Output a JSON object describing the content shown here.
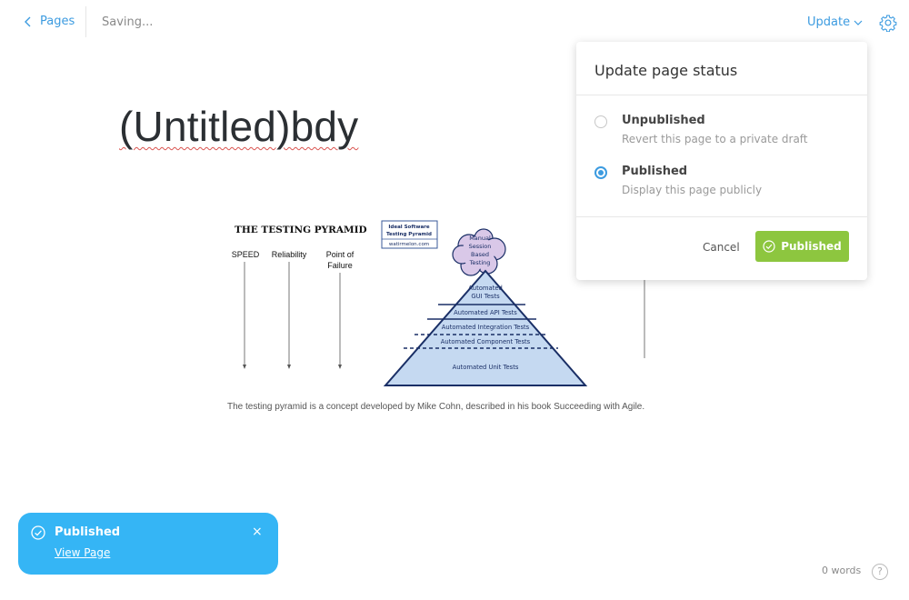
{
  "topbar": {
    "back_label": "Pages",
    "status": "Saving...",
    "update_label": "Update"
  },
  "page": {
    "title": "(Untitled)bdy",
    "caption": "The testing pyramid is a concept developed by Mike Cohn, described in his book Succeeding with Agile."
  },
  "figure": {
    "heading": "THE TESTING PYRAMID",
    "badge_line1": "Ideal Software",
    "badge_line2": "Testing Pyramid",
    "badge_line3": "watirmelon.com",
    "col1": "SPEED",
    "col2": "Reliability",
    "col3_line1": "Point of",
    "col3_line2": "Failure",
    "cloud_line1": "Manual",
    "cloud_line2": "Session",
    "cloud_line3": "Based",
    "cloud_line4": "Testing",
    "layer_gui_1": "Automated",
    "layer_gui_2": "GUI Tests",
    "layer_api": "Automated API Tests",
    "layer_integration": "Automated Integration Tests",
    "layer_component": "Automated Component Tests",
    "layer_unit": "Automated Unit Tests"
  },
  "popover": {
    "title": "Update page status",
    "options": [
      {
        "label": "Unpublished",
        "description": "Revert this page to a private draft",
        "selected": false
      },
      {
        "label": "Published",
        "description": "Display this page publicly",
        "selected": true
      }
    ],
    "cancel_label": "Cancel",
    "confirm_label": "Published"
  },
  "toast": {
    "title": "Published",
    "link": "View Page",
    "close": "×"
  },
  "footer": {
    "words": "0 words",
    "help": "?"
  },
  "colors": {
    "accent": "#3c9be0",
    "success": "#8dc63f",
    "toast": "#35b5f5"
  }
}
